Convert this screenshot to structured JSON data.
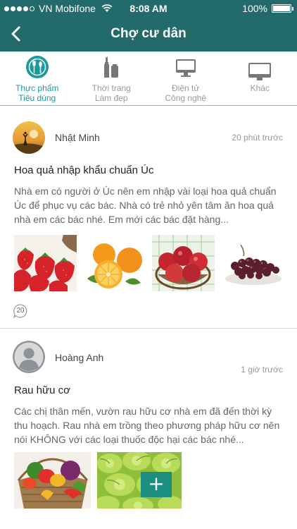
{
  "status_bar": {
    "carrier": "VN Mobifone",
    "time": "8:08 AM",
    "battery": "100%"
  },
  "nav": {
    "back_icon": "chevron-left-icon",
    "title": "Chợ cư dân"
  },
  "categories": [
    {
      "icon": "food-icon",
      "label_line1": "Thực phẩm",
      "label_line2": "Tiêu dùng",
      "active": true
    },
    {
      "icon": "cosmetics-icon",
      "label_line1": "Thời trang",
      "label_line2": "Làm đẹp",
      "active": false
    },
    {
      "icon": "electronics-icon",
      "label_line1": "Điện tử",
      "label_line2": "Công nghệ",
      "active": false
    },
    {
      "icon": "monitor-icon",
      "label_line1": "Khác",
      "label_line2": "",
      "active": false
    }
  ],
  "posts": [
    {
      "author": "Nhật Minh",
      "time_ago": "20 phút trước",
      "title": "Hoa quả nhập khẩu chuẩn Úc",
      "body": "Nhà em có người ở Úc nên em nhập vài loại hoa quả chuẩn Úc để phục vụ các bác. Nhà có trẻ nhỏ yên tâm ăn hoa quả nhà em các bác nhé. Em mới các bác đặt hàng...",
      "comment_count": "20"
    },
    {
      "author": "Hoàng Anh",
      "time_ago": "1 giờ trước",
      "title": "Rau hữu cơ",
      "body": "Các chị thân mến, vườn rau hữu cơ nhà em đã đến thời kỳ thu hoạch. Rau nhà em trồng theo phương pháp hữu cơ nên nói KHÔNG với các loại thuốc độc hại các bác nhé...",
      "add_button": "+"
    }
  ],
  "colors": {
    "header": "#226a6c",
    "accent": "#1a9a9c",
    "add_button": "#1a8f80"
  }
}
